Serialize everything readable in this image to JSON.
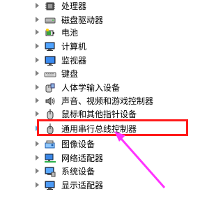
{
  "device_manager": {
    "tree_items": [
      {
        "label": "处理器",
        "icon": "processor-icon"
      },
      {
        "label": "磁盘驱动器",
        "icon": "disk-drive-icon"
      },
      {
        "label": "电池",
        "icon": "battery-icon"
      },
      {
        "label": "计算机",
        "icon": "computer-icon"
      },
      {
        "label": "监视器",
        "icon": "monitor-icon"
      },
      {
        "label": "键盘",
        "icon": "keyboard-icon"
      },
      {
        "label": "人体学输入设备",
        "icon": "hid-icon"
      },
      {
        "label": "声音、视频和游戏控制器",
        "icon": "sound-icon"
      },
      {
        "label": "鼠标和其他指针设备",
        "icon": "mouse-icon"
      },
      {
        "label": "通用串行总线控制器",
        "icon": "usb-controller-icon"
      },
      {
        "label": "图像设备",
        "icon": "imaging-device-icon"
      },
      {
        "label": "网络适配器",
        "icon": "network-adapter-icon"
      },
      {
        "label": "系统设备",
        "icon": "system-device-icon"
      },
      {
        "label": "显示适配器",
        "icon": "display-adapter-icon"
      }
    ],
    "highlighted_item": "通用串行总线控制器"
  },
  "annotation": {
    "box_color": "#ff1a1a",
    "arrow_color": "#ff33ff"
  }
}
